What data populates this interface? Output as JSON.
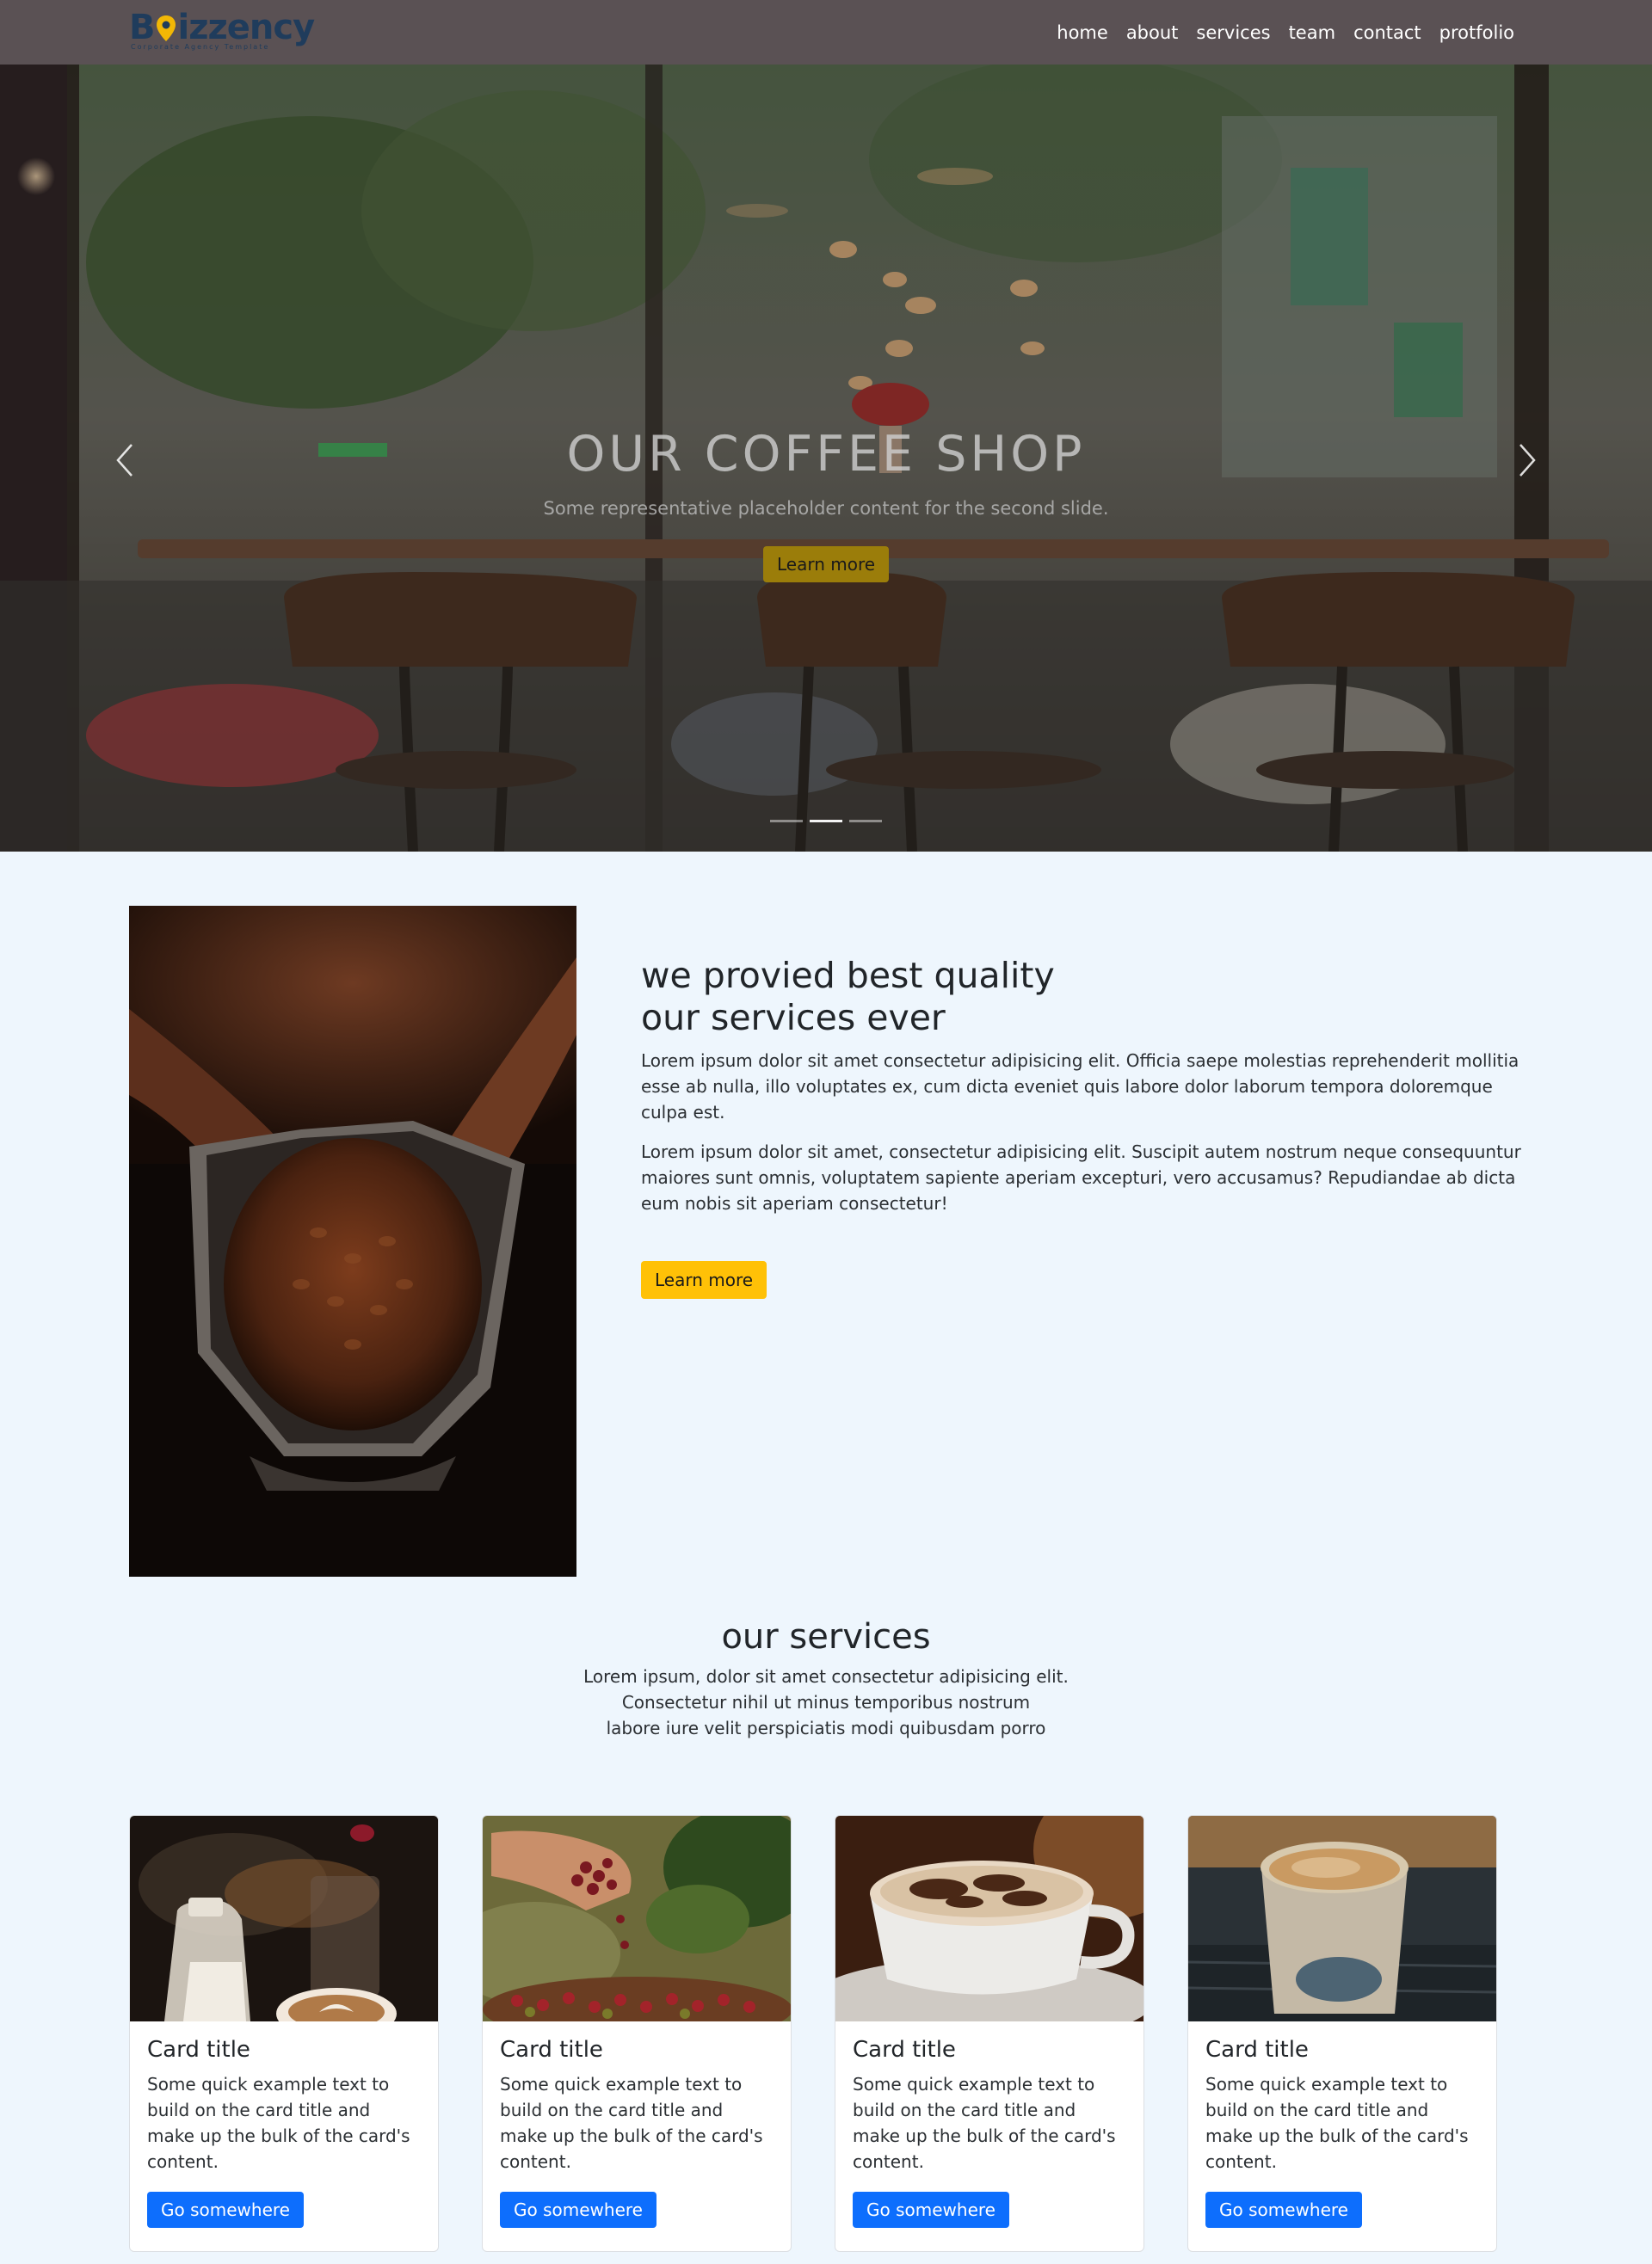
{
  "navbar": {
    "brand_name": "izzency",
    "brand_initial": "B",
    "brand_tagline": "Corporate Agency Template",
    "links": [
      "home",
      "about",
      "services",
      "team",
      "contact",
      "protfolio"
    ]
  },
  "hero": {
    "title": "OUR COFFEE SHOP",
    "subtitle": "Some representative placeholder content for the second slide.",
    "button": "Learn more",
    "active_slide": 2,
    "slide_count": 3
  },
  "about": {
    "heading_line1": "we provied best quality",
    "heading_line2": "our services ever",
    "paragraph1": "Lorem ipsum dolor sit amet consectetur adipisicing elit. Officia saepe molestias reprehenderit mollitia esse ab nulla, illo voluptates ex, cum dicta eveniet quis labore dolor laborum tempora doloremque culpa est.",
    "paragraph2": "Lorem ipsum dolor sit amet, consectetur adipisicing elit. Suscipit autem nostrum neque consequuntur maiores sunt omnis, voluptatem sapiente aperiam excepturi, vero accusamus? Repudiandae ab dicta eum nobis sit aperiam consectetur!",
    "button": "Learn more"
  },
  "services": {
    "title": "our services",
    "desc_line1": "Lorem ipsum, dolor sit amet consectetur adipisicing elit.",
    "desc_line2": "Consectetur nihil ut minus temporibus nostrum",
    "desc_line3": "labore iure velit perspiciatis modi quibusdam porro"
  },
  "cards": [
    {
      "title": "Card title",
      "text": "Some quick example text to build on the card title and make up the bulk of the card's content.",
      "button": "Go somewhere"
    },
    {
      "title": "Card title",
      "text": "Some quick example text to build on the card title and make up the bulk of the card's content.",
      "button": "Go somewhere"
    },
    {
      "title": "Card title",
      "text": "Some quick example text to build on the card title and make up the bulk of the card's content.",
      "button": "Go somewhere"
    },
    {
      "title": "Card title",
      "text": "Some quick example text to build on the card title and make up the bulk of the card's content.",
      "button": "Go somewhere"
    }
  ],
  "colors": {
    "navbar_bg": "#5a5154",
    "page_bg": "#eef6fd",
    "accent_yellow": "#ffc107",
    "accent_blue": "#0d6efd",
    "brand_navy": "#1f3c5c"
  },
  "icons": {
    "carousel_prev": "chevron-left-icon",
    "carousel_next": "chevron-right-icon",
    "brand_pin": "map-pin-icon"
  }
}
